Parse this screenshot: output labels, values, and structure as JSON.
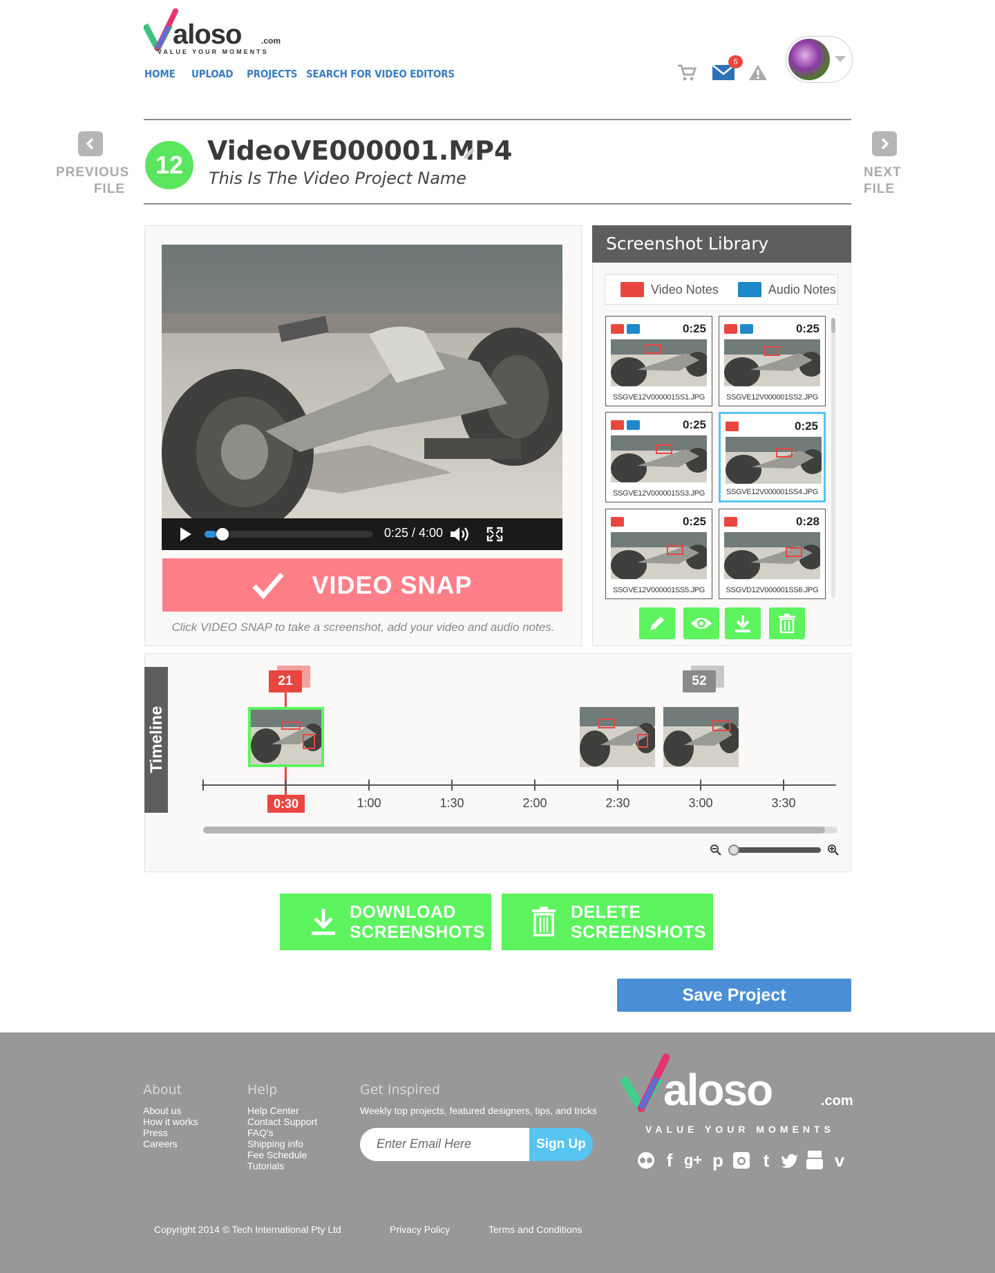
{
  "brand": {
    "name": "aloso",
    "tld": ".com",
    "tagline": "VALUE YOUR MOMENTS"
  },
  "nav": [
    {
      "label": "HOME"
    },
    {
      "label": "UPLOAD"
    },
    {
      "label": "PROJECTS"
    },
    {
      "label": "SEARCH FOR VIDEO EDITORS"
    }
  ],
  "header_icons": {
    "cart": "cart-icon",
    "mail": "mail-icon",
    "mail_badge": "5",
    "alert": "alert-icon",
    "avatar": "avatar"
  },
  "project": {
    "prev_label": "PREVIOUS FILE",
    "next_label": "NEXT FILE",
    "number": "12",
    "file_name": "VideoVE000001.MP4",
    "project_name": "This Is The Video Project Name"
  },
  "player": {
    "time": "0:25 / 4:00",
    "progress": 0.07,
    "snap_label": "VIDEO SNAP",
    "hint": "Click VIDEO SNAP to take a screenshot, add your video and audio notes."
  },
  "library": {
    "title": "Screenshot Library",
    "legend": [
      {
        "label": "Video Notes",
        "color": "#e8463f"
      },
      {
        "label": "Audio Notes",
        "color": "#1e88c8"
      }
    ],
    "thumbs": [
      {
        "time": "0:25",
        "file": "SSGVE12V000001SS1.JPG",
        "video": true,
        "audio": true,
        "selected": false
      },
      {
        "time": "0:25",
        "file": "SSGVE12V000001SS2.JPG",
        "video": true,
        "audio": true,
        "selected": false
      },
      {
        "time": "0:25",
        "file": "SSGVE12V000001SS3.JPG",
        "video": true,
        "audio": true,
        "selected": false
      },
      {
        "time": "0:25",
        "file": "SSGVE12V000001SS4.JPG",
        "video": true,
        "audio": false,
        "selected": true
      },
      {
        "time": "0:25",
        "file": "SSGVE12V000001SS5.JPG",
        "video": true,
        "audio": false,
        "selected": false
      },
      {
        "time": "0:28",
        "file": "SSGVD12V000001SS6.JPG",
        "video": true,
        "audio": false,
        "selected": false
      }
    ],
    "actions": [
      "edit-icon",
      "view-icon",
      "download-icon",
      "trash-icon"
    ]
  },
  "timeline": {
    "label": "Timeline",
    "ticks": [
      "0:30",
      "1:00",
      "1:30",
      "2:00",
      "2:30",
      "3:00",
      "3:30"
    ],
    "marker_count_red": "21",
    "marker_count_grey": "52",
    "current_label": "0:30"
  },
  "buttons": {
    "download_line1": "DOWNLOAD",
    "download_line2": "SCREENSHOTS",
    "delete_line1": "DELETE",
    "delete_line2": "SCREENSHOTS",
    "save": "Save Project"
  },
  "footer": {
    "about": {
      "title": "About",
      "links": [
        "About us",
        "How it works",
        "Press",
        "Careers"
      ]
    },
    "help": {
      "title": "Help",
      "links": [
        "Help Center",
        "Contact Support",
        "FAQ's",
        "Shipping info",
        "Fee Schedule",
        "Tutorials"
      ]
    },
    "inspired": {
      "title": "Get Inspired",
      "text": "Weekly top projects, featured designers, tips, and tricks",
      "placeholder": "Enter Email Here",
      "signup": "Sign Up"
    },
    "social": [
      "flickr-icon",
      "facebook-icon",
      "google-plus-icon",
      "pinterest-icon",
      "instagram-icon",
      "tumblr-icon",
      "twitter-icon",
      "youtube-icon",
      "vimeo-icon"
    ],
    "copyright": "Copyright 2014 © Tech International Pty Ltd",
    "privacy": "Privacy Policy",
    "terms": "Terms and Conditions"
  }
}
